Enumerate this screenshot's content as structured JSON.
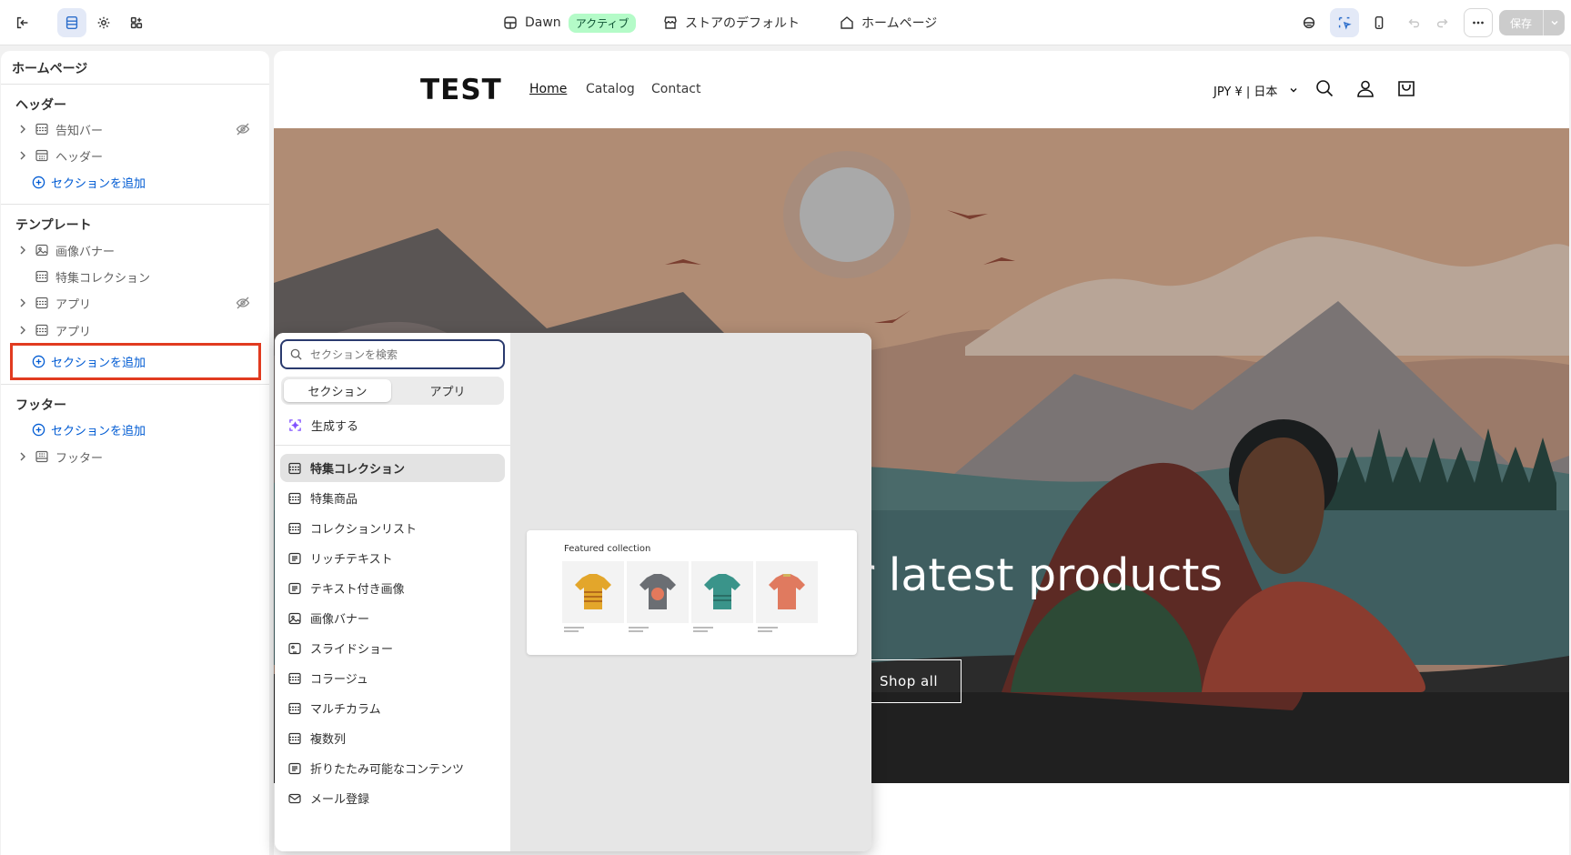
{
  "topbar": {
    "theme_name": "Dawn",
    "theme_status": "アクティブ",
    "store_default": "ストアのデフォルト",
    "page": "ホームページ",
    "save_label": "保存"
  },
  "sidebar": {
    "title": "ホームページ",
    "header_group": "ヘッダー",
    "header_items": [
      {
        "label": "告知バー"
      },
      {
        "label": "ヘッダー"
      }
    ],
    "add_section": "セクションを追加",
    "template_group": "テンプレート",
    "template_items": [
      {
        "label": "画像バナー"
      },
      {
        "label": "特集コレクション"
      },
      {
        "label": "アプリ"
      },
      {
        "label": "アプリ"
      }
    ],
    "footer_group": "フッター",
    "footer_items": [
      {
        "label": "フッター"
      }
    ]
  },
  "store": {
    "logo": "TEST",
    "nav": [
      "Home",
      "Catalog",
      "Contact"
    ],
    "currency": "JPY ¥ | 日本",
    "hero_heading": "r latest products",
    "hero_button": "Shop all"
  },
  "picker": {
    "search_placeholder": "セクションを検索",
    "tabs": [
      "セクション",
      "アプリ"
    ],
    "generate": "生成する",
    "items": [
      "特集コレクション",
      "特集商品",
      "コレクションリスト",
      "リッチテキスト",
      "テキスト付き画像",
      "画像バナー",
      "スライドショー",
      "コラージュ",
      "マルチカラム",
      "複数列",
      "折りたたみ可能なコンテンツ",
      "メール登録"
    ],
    "preview_title": "Featured collection"
  },
  "colors": {
    "accent": "#005bd3",
    "highlight": "#e13b20",
    "badge_bg": "#b4fbc8"
  }
}
